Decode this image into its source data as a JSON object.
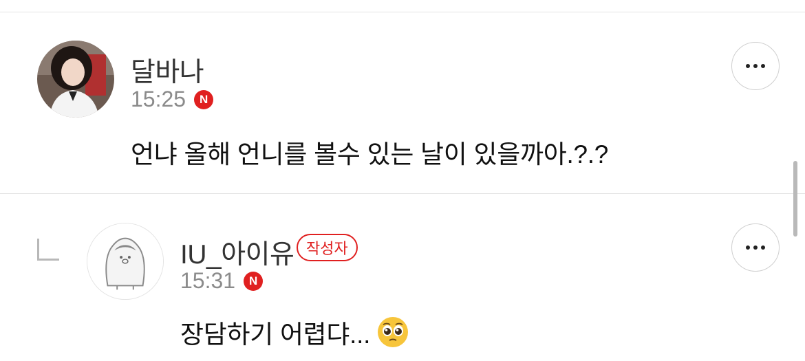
{
  "comments": [
    {
      "author": "달바나",
      "time": "15:25",
      "platform_badge": "N",
      "text": "언냐 올해 언니를 볼수 있는 날이 있을까아.?.?",
      "avatar": "user-photo-avatar"
    },
    {
      "author": "IU_아이유",
      "author_badge": "작성자",
      "time": "15:31",
      "platform_badge": "N",
      "text": "장담하기 어렵댜...",
      "emoji": "pleading-face-emoji",
      "avatar": "penguin-avatar",
      "is_reply": true
    }
  ],
  "colors": {
    "badge_red": "#e02020",
    "time_gray": "#8b8b8b",
    "divider": "#e4e4e4"
  }
}
